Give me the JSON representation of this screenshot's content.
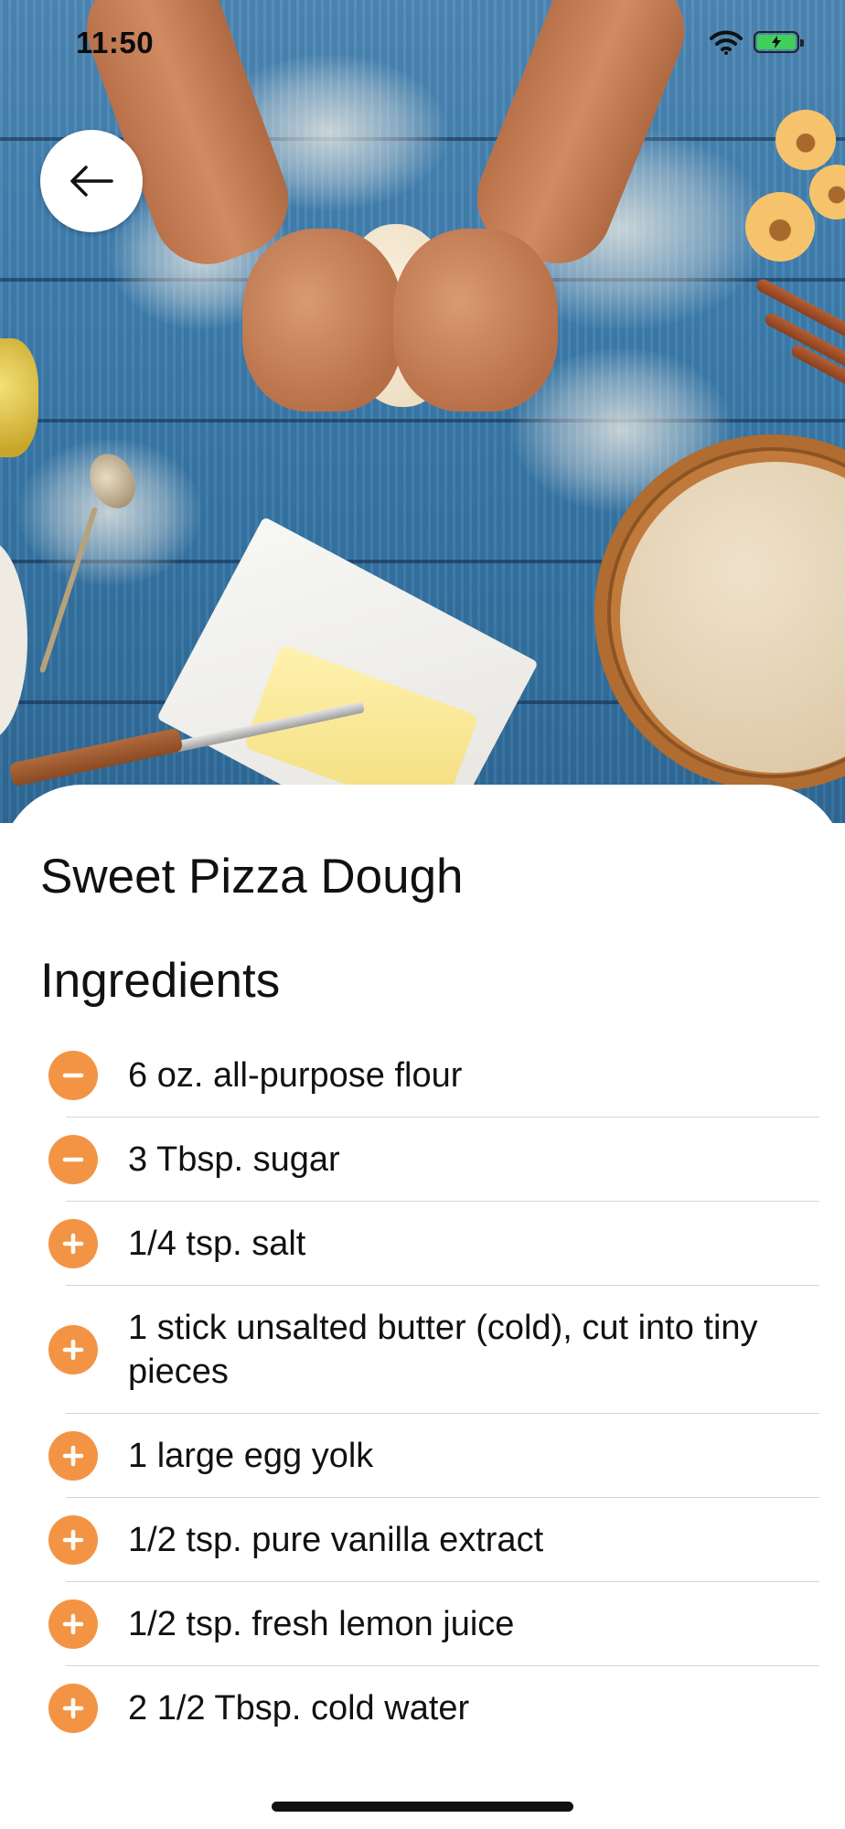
{
  "status_bar": {
    "time": "11:50",
    "wifi_icon": "wifi-icon",
    "battery_icon": "battery-charging-icon"
  },
  "header": {
    "back_icon": "arrow-left-icon",
    "hero_image": "pizza-dough-kneading-photo"
  },
  "recipe": {
    "title": "Sweet Pizza Dough",
    "section_title": "Ingredients",
    "ingredients": [
      {
        "text": "6 oz. all-purpose flour",
        "state": "minus"
      },
      {
        "text": "3 Tbsp. sugar",
        "state": "minus"
      },
      {
        "text": "1/4 tsp. salt",
        "state": "plus"
      },
      {
        "text": "1 stick unsalted butter (cold), cut into tiny pieces",
        "state": "plus"
      },
      {
        "text": "1 large egg yolk",
        "state": "plus"
      },
      {
        "text": "1/2 tsp. pure vanilla extract",
        "state": "plus"
      },
      {
        "text": "1/2 tsp. fresh lemon juice",
        "state": "plus"
      },
      {
        "text": "2 1/2 Tbsp. cold water",
        "state": "plus"
      }
    ]
  },
  "colors": {
    "accent": "#f39445",
    "background": "#ffffff",
    "text": "#111111",
    "separator": "#d4d4d4"
  }
}
